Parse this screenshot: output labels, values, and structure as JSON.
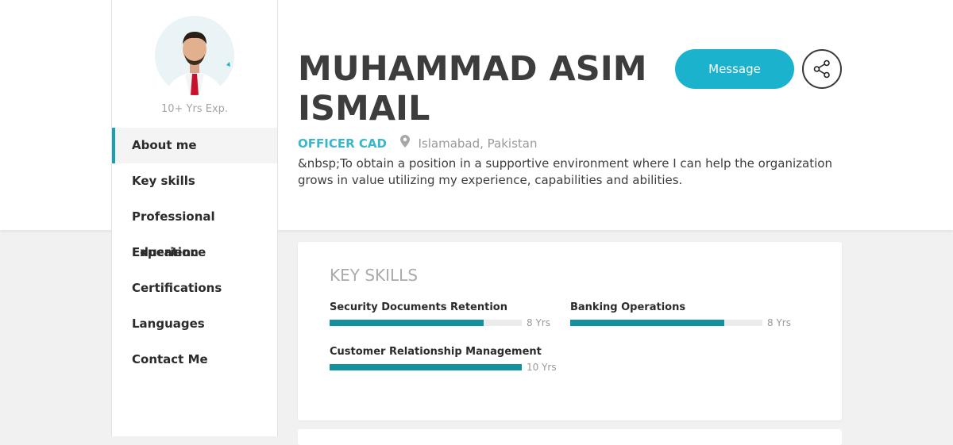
{
  "profile": {
    "name_line1": "MUHAMMAD ASIM",
    "name_line2": "ISMAIL",
    "job_title": "OFFICER CAD",
    "location": "Islamabad, Pakistan",
    "objective": "&nbsp;To obtain a position in a supportive environment where I can help the organization grows in value utilizing my experience, capabilities and abilities.",
    "experience": "10+ Yrs Exp."
  },
  "actions": {
    "message_label": "Message"
  },
  "sidebar": {
    "items": [
      {
        "label": "About me",
        "active": true
      },
      {
        "label": "Key skills"
      },
      {
        "label": "Professional Experience"
      },
      {
        "label": "Education"
      },
      {
        "label": "Certifications"
      },
      {
        "label": "Languages"
      },
      {
        "label": "Contact Me"
      }
    ]
  },
  "skills_section": {
    "title": "KEY SKILLS",
    "skills": [
      {
        "name": "Security Documents Retention",
        "years": "8 Yrs",
        "level": 0.8
      },
      {
        "name": "Banking Operations",
        "years": "8 Yrs",
        "level": 0.8
      },
      {
        "name": "Customer Relationship Management",
        "years": "10 Yrs",
        "level": 1.0
      }
    ]
  },
  "colors": {
    "accent": "#1ab2cd",
    "bar_fill": "#14909e",
    "job_title": "#39b8cc"
  }
}
